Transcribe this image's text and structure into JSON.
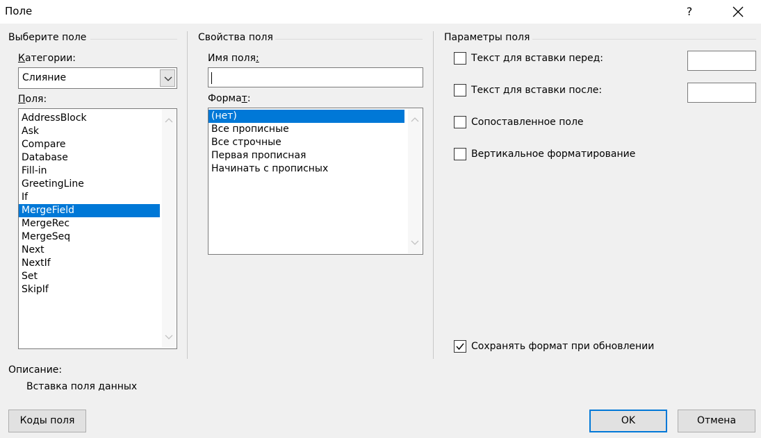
{
  "window": {
    "title": "Поле",
    "help_glyph": "?"
  },
  "choose_field": {
    "group_title": "Выберите поле",
    "categories_label": "Категории:",
    "category_value": "Слияние",
    "fields_label": "Поля:",
    "fields": [
      {
        "label": "AddressBlock",
        "selected": false
      },
      {
        "label": "Ask",
        "selected": false
      },
      {
        "label": "Compare",
        "selected": false
      },
      {
        "label": "Database",
        "selected": false
      },
      {
        "label": "Fill-in",
        "selected": false
      },
      {
        "label": "GreetingLine",
        "selected": false
      },
      {
        "label": "If",
        "selected": false
      },
      {
        "label": "MergeField",
        "selected": true
      },
      {
        "label": "MergeRec",
        "selected": false
      },
      {
        "label": "MergeSeq",
        "selected": false
      },
      {
        "label": "Next",
        "selected": false
      },
      {
        "label": "NextIf",
        "selected": false
      },
      {
        "label": "Set",
        "selected": false
      },
      {
        "label": "SkipIf",
        "selected": false
      }
    ]
  },
  "field_properties": {
    "group_title": "Свойства поля",
    "field_name_label": "Имя поля:",
    "field_name_value": "",
    "format_label": "Формат:",
    "formats": [
      {
        "label": "(нет)",
        "selected": true
      },
      {
        "label": "Все прописные",
        "selected": false
      },
      {
        "label": "Все строчные",
        "selected": false
      },
      {
        "label": "Первая прописная",
        "selected": false
      },
      {
        "label": "Начинать с прописных",
        "selected": false
      }
    ]
  },
  "field_options": {
    "group_title": "Параметры поля",
    "text_before_label": "Текст для вставки перед:",
    "text_before_checked": false,
    "text_before_value": "",
    "text_after_label": "Текст для вставки после:",
    "text_after_checked": false,
    "text_after_value": "",
    "mapped_field_label": "Сопоставленное поле",
    "mapped_field_checked": false,
    "vertical_format_label": "Вертикальное форматирование",
    "vertical_format_checked": false,
    "preserve_format_label": "Сохранять формат при обновлении",
    "preserve_format_checked": true
  },
  "description": {
    "label": "Описание:",
    "text": "Вставка поля данных"
  },
  "buttons": {
    "field_codes": "Коды поля",
    "ok": "OK",
    "cancel": "Отмена"
  },
  "colors": {
    "selection": "#0078d7",
    "dialog_bg": "#f0f0f0"
  },
  "icons": {
    "close": "close-icon",
    "help": "help-icon",
    "dropdown": "chevron-down-icon",
    "scroll_up": "chevron-up-icon",
    "scroll_down": "chevron-down-icon",
    "check": "check-icon"
  }
}
